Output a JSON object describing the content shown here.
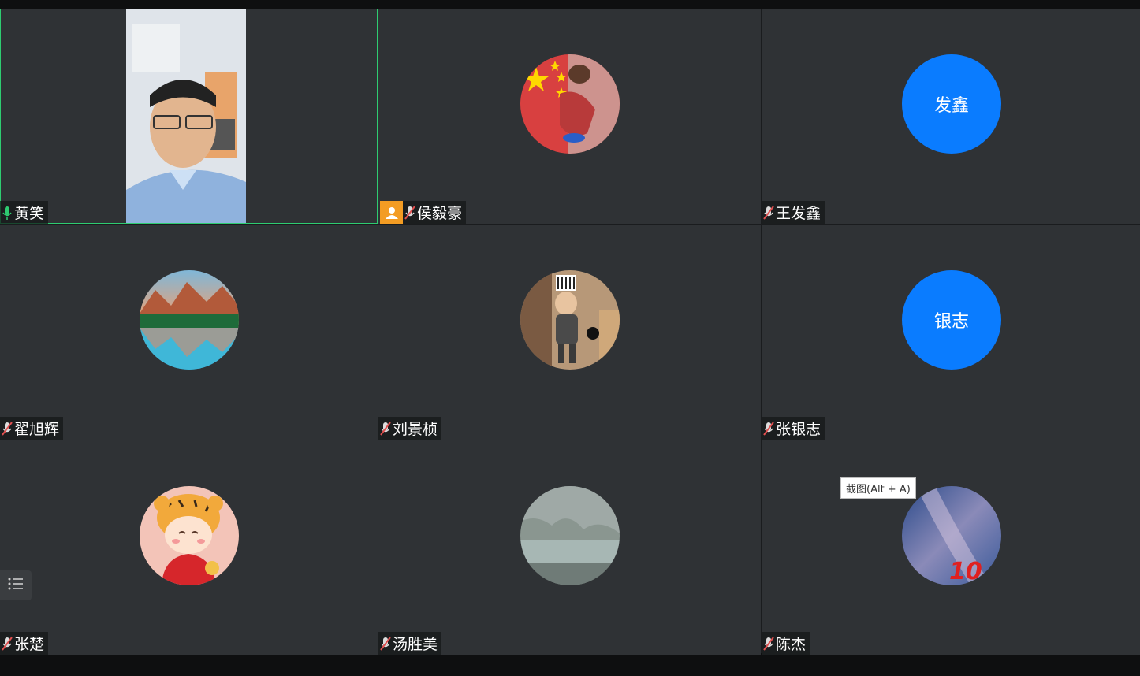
{
  "participants": [
    {
      "name": "黄笑",
      "mic": "on",
      "type": "video"
    },
    {
      "name": "侯毅豪",
      "mic": "muted",
      "type": "photo",
      "host": true
    },
    {
      "name": "王发鑫",
      "mic": "muted",
      "type": "text",
      "avatar_text": "发鑫"
    },
    {
      "name": "翟旭辉",
      "mic": "muted",
      "type": "photo"
    },
    {
      "name": "刘景桢",
      "mic": "muted",
      "type": "photo"
    },
    {
      "name": "张银志",
      "mic": "muted",
      "type": "text",
      "avatar_text": "银志"
    },
    {
      "name": "张楚",
      "mic": "muted",
      "type": "photo"
    },
    {
      "name": "汤胜美",
      "mic": "muted",
      "type": "photo"
    },
    {
      "name": "陈杰",
      "mic": "muted",
      "type": "photo"
    }
  ],
  "tooltip": "截图(Alt + A)",
  "colors": {
    "text_avatar": "#0a7cff",
    "host_badge": "#f39c23",
    "active_border": "#2ecc71",
    "muted_icon": "#e05050"
  }
}
